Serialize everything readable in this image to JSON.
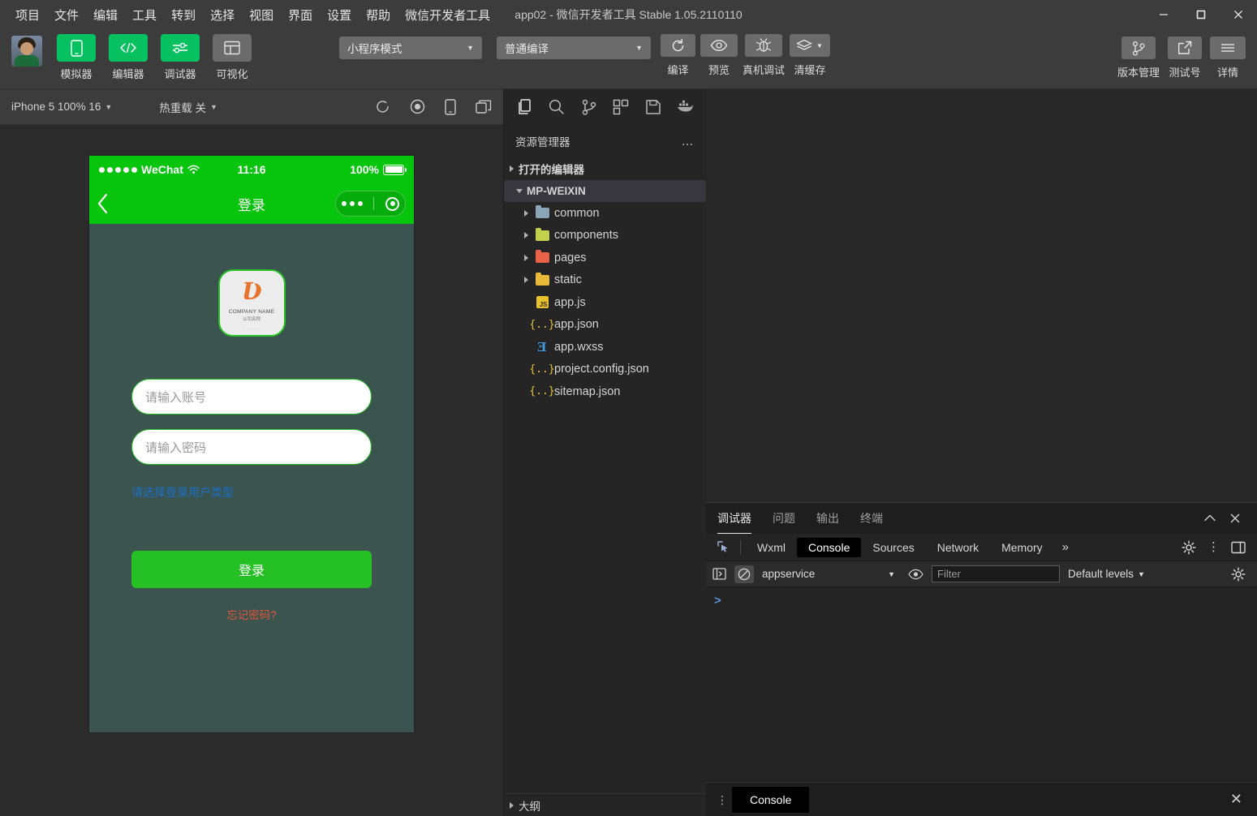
{
  "window": {
    "title": "app02  -  微信开发者工具 Stable 1.05.2110110",
    "minimize": "minimize-icon",
    "maximize": "maximize-icon",
    "close": "close-icon"
  },
  "menubar": {
    "items": [
      {
        "label": "项目"
      },
      {
        "label": "文件"
      },
      {
        "label": "编辑"
      },
      {
        "label": "工具"
      },
      {
        "label": "转到"
      },
      {
        "label": "选择"
      },
      {
        "label": "视图"
      },
      {
        "label": "界面"
      },
      {
        "label": "设置"
      },
      {
        "label": "帮助"
      },
      {
        "label": "微信开发者工具"
      }
    ]
  },
  "toolbar": {
    "panel_buttons": [
      {
        "label": "模拟器",
        "icon": "phone-icon",
        "active": true
      },
      {
        "label": "编辑器",
        "icon": "code-icon",
        "active": true
      },
      {
        "label": "调试器",
        "icon": "debug-slider-icon",
        "active": true
      },
      {
        "label": "可视化",
        "icon": "layout-icon",
        "active": false
      }
    ],
    "mode_select": {
      "value": "小程序模式"
    },
    "compile_select": {
      "value": "普通编译"
    },
    "actions": [
      {
        "label": "编译",
        "icon": "refresh-icon"
      },
      {
        "label": "预览",
        "icon": "eye-icon"
      },
      {
        "label": "真机调试",
        "icon": "bug-icon"
      },
      {
        "label": "清缓存",
        "icon": "layers-icon"
      }
    ],
    "right_actions": [
      {
        "label": "版本管理",
        "icon": "branch-icon"
      },
      {
        "label": "测试号",
        "icon": "external-link-icon"
      },
      {
        "label": "详情",
        "icon": "hamburger-icon"
      }
    ]
  },
  "simulator": {
    "device": "iPhone 5 100% 16",
    "hot_reload": "热重载 关",
    "icons": [
      "refresh-icon",
      "record-icon",
      "device-icon",
      "multi-window-icon"
    ],
    "status_bar": {
      "carrier": "WeChat",
      "time": "11:16",
      "battery_text": "100%"
    },
    "nav": {
      "back": "back-chevron-icon",
      "title": "登录",
      "capsule_more": "more-dots-icon",
      "capsule_target": "target-icon"
    },
    "page": {
      "logo": {
        "mark": "Ʋ",
        "company": "COMPANY NAME",
        "company_cn": "公司名称",
        "sub": "· · · · ·"
      },
      "account_placeholder": "请输入账号",
      "password_placeholder": "请输入密码",
      "select_type_link": "请选择登录用户类型",
      "login_button": "登录",
      "forgot_password": "忘记密码?"
    }
  },
  "explorer": {
    "activity_icons": [
      "files-icon",
      "search-icon",
      "source-control-icon",
      "extensions-icon",
      "save-all-icon",
      "docker-icon"
    ],
    "title": "资源管理器",
    "more": "…",
    "sections": [
      {
        "label": "打开的编辑器",
        "expanded": false
      },
      {
        "label": "MP-WEIXIN",
        "expanded": true
      }
    ],
    "tree": [
      {
        "label": "common",
        "type": "folder",
        "color": "#8aa5b5",
        "indent": 1,
        "arrow": "collapsed"
      },
      {
        "label": "components",
        "type": "folder",
        "color": "#c2d04b",
        "indent": 1,
        "arrow": "collapsed"
      },
      {
        "label": "pages",
        "type": "folder",
        "color": "#e8634a",
        "indent": 1,
        "arrow": "collapsed"
      },
      {
        "label": "static",
        "type": "folder",
        "color": "#e8b93a",
        "indent": 1,
        "arrow": "collapsed"
      },
      {
        "label": "app.js",
        "type": "js",
        "indent": 1,
        "arrow": "none"
      },
      {
        "label": "app.json",
        "type": "json",
        "indent": 1,
        "arrow": "none"
      },
      {
        "label": "app.wxss",
        "type": "wxss",
        "indent": 1,
        "arrow": "none"
      },
      {
        "label": "project.config.json",
        "type": "json",
        "indent": 1,
        "arrow": "none"
      },
      {
        "label": "sitemap.json",
        "type": "json",
        "indent": 1,
        "arrow": "none"
      }
    ],
    "outline": "大纲"
  },
  "panel": {
    "tabs": [
      {
        "label": "调试器",
        "active": true
      },
      {
        "label": "问题",
        "active": false
      },
      {
        "label": "输出",
        "active": false
      },
      {
        "label": "终端",
        "active": false
      }
    ],
    "collapse_icon": "chevron-up-icon",
    "close_icon": "close-icon",
    "devtools_tabs": [
      {
        "label": "Wxml",
        "active": false
      },
      {
        "label": "Console",
        "active": true
      },
      {
        "label": "Sources",
        "active": false
      },
      {
        "label": "Network",
        "active": false
      },
      {
        "label": "Memory",
        "active": false
      }
    ],
    "devtools_more": "»",
    "devtools_right_icons": [
      "settings-gear-icon",
      "kebab-menu-icon",
      "dock-side-icon"
    ],
    "console_toolbar": {
      "sidebar_icon": "console-sidebar-icon",
      "clear_icon": "clear-console-icon",
      "context": "appservice",
      "eye_icon": "live-expression-icon",
      "filter_placeholder": "Filter",
      "levels": "Default levels",
      "settings_icon": "settings-gear-icon"
    },
    "console_prompt": ">",
    "drawer": {
      "kebab": "⋮",
      "tab": "Console",
      "close": "✕"
    }
  },
  "colors": {
    "accent_green": "#07c160",
    "wechat_green": "#07c40d",
    "link_blue": "#1a6fc4",
    "warn_red": "#e0563a"
  }
}
